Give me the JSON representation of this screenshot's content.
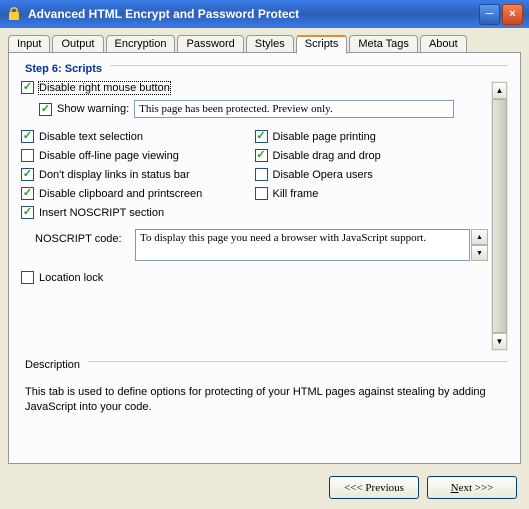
{
  "window": {
    "title": "Advanced HTML Encrypt and Password Protect"
  },
  "tabs": [
    "Input",
    "Output",
    "Encryption",
    "Password",
    "Styles",
    "Scripts",
    "Meta Tags",
    "About"
  ],
  "activeTab": "Scripts",
  "step": {
    "title": "Step 6: Scripts"
  },
  "options": {
    "disableRightMouse": {
      "label": "Disable right mouse button",
      "checked": true
    },
    "showWarning": {
      "label": "Show warning:",
      "checked": true,
      "value": "This page has been protected. Preview only."
    },
    "disableTextSelection": {
      "label": "Disable text selection",
      "checked": true
    },
    "disablePagePrinting": {
      "label": "Disable page printing",
      "checked": true
    },
    "disableOffline": {
      "label": "Disable off-line page viewing",
      "checked": false
    },
    "disableDragDrop": {
      "label": "Disable drag and drop",
      "checked": true
    },
    "dontDisplayLinks": {
      "label": "Don't display links in status bar",
      "checked": true
    },
    "disableOpera": {
      "label": "Disable Opera users",
      "checked": false
    },
    "disableClipboard": {
      "label": "Disable clipboard and printscreen",
      "checked": true
    },
    "killFrame": {
      "label": "Kill frame",
      "checked": false
    },
    "insertNoscript": {
      "label": "Insert NOSCRIPT section",
      "checked": true
    },
    "noscriptCode": {
      "label": "NOSCRIPT code:",
      "value": "To display this page you need a browser with JavaScript support."
    },
    "locationLock": {
      "label": "Location lock",
      "checked": false
    }
  },
  "description": {
    "title": "Description",
    "text": "This tab is used to define options for protecting of your HTML pages against stealing by adding JavaScript into your code."
  },
  "buttons": {
    "previous": "<<< Previous",
    "nextPrefix": "N",
    "nextSuffix": "ext >>>"
  }
}
